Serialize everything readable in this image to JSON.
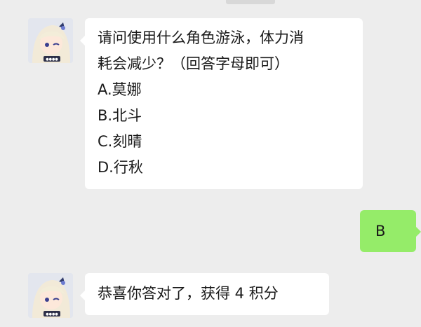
{
  "chat": {
    "messages": [
      {
        "sender": "other",
        "lines": [
          "请问使用什么角色游泳，体力消",
          "耗会减少？（回答字母即可）",
          "A.莫娜",
          "B.北斗",
          "C.刻晴",
          "D.行秋"
        ]
      },
      {
        "sender": "self",
        "text": "B"
      },
      {
        "sender": "other",
        "text": "恭喜你答对了，获得 4 积分"
      }
    ]
  },
  "colors": {
    "background": "#ededed",
    "incoming_bubble": "#ffffff",
    "outgoing_bubble": "#95ec69",
    "text": "#191919"
  }
}
